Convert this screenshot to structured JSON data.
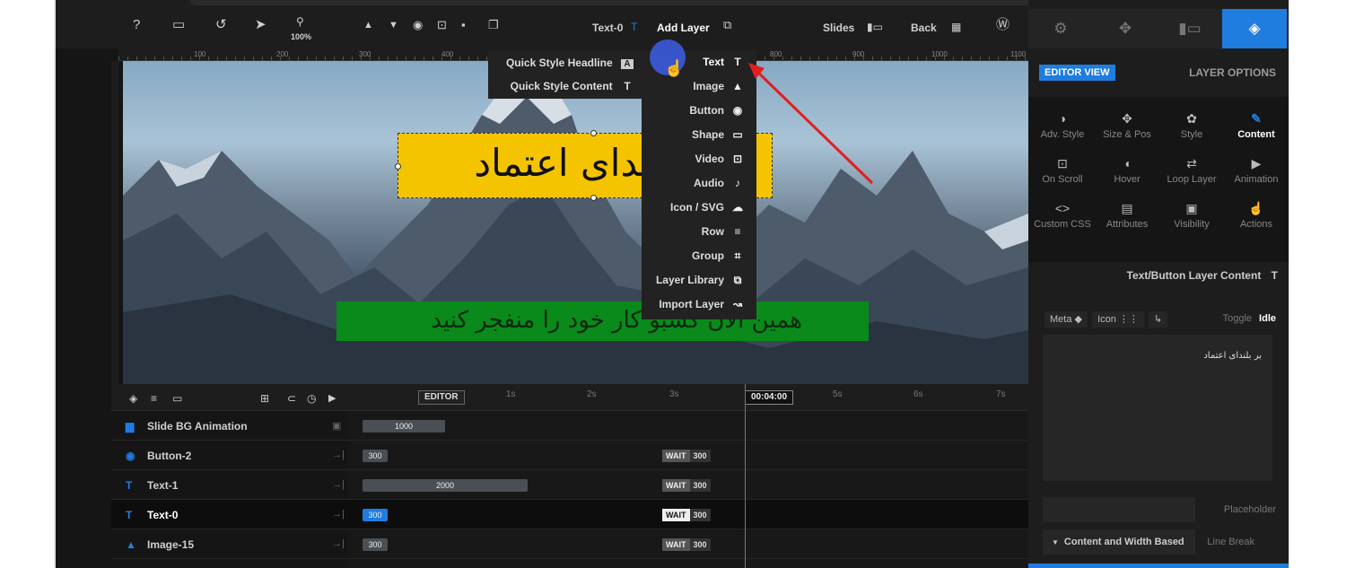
{
  "toolbar": {
    "zoom": "100%",
    "layer_name": "Text-0",
    "add_layer": "Add Layer",
    "slides": "Slides",
    "back": "Back"
  },
  "ruler": {
    "marks": [
      "100",
      "200",
      "300",
      "400",
      "800",
      "900",
      "1000",
      "1100"
    ]
  },
  "canvas": {
    "headline": "بر بلندای اعتماد",
    "subtext": "همین الان کسبو کار خود را منفجر کنید"
  },
  "quick_menu": {
    "items": [
      {
        "label": "Quick Style Headline",
        "icon": "A"
      },
      {
        "label": "Quick Style Content",
        "icon": "T"
      }
    ]
  },
  "add_menu": {
    "items": [
      {
        "label": "Text",
        "icon": "text-icon"
      },
      {
        "label": "Image",
        "icon": "image-icon"
      },
      {
        "label": "Button",
        "icon": "button-icon"
      },
      {
        "label": "Shape",
        "icon": "shape-icon"
      },
      {
        "label": "Video",
        "icon": "video-icon"
      },
      {
        "label": "Audio",
        "icon": "audio-icon"
      },
      {
        "label": "Icon / SVG",
        "icon": "cloud-icon"
      },
      {
        "label": "Row",
        "icon": "row-icon"
      },
      {
        "label": "Group",
        "icon": "group-icon"
      },
      {
        "label": "Layer Library",
        "icon": "library-icon"
      },
      {
        "label": "Import Layer",
        "icon": "import-icon"
      }
    ]
  },
  "timeline": {
    "editor_tag": "EDITOR",
    "current_time": "00:04:00",
    "ticks": [
      "1s",
      "2s",
      "3s",
      "5s",
      "6s",
      "7s"
    ],
    "rows": [
      {
        "name": "Slide BG Animation",
        "bar": "1000",
        "wait": "",
        "delay": ""
      },
      {
        "name": "Button-2",
        "bar": "300",
        "wait": "WAIT",
        "delay": "300"
      },
      {
        "name": "Text-1",
        "bar": "2000",
        "wait": "WAIT",
        "delay": "300"
      },
      {
        "name": "Text-0",
        "bar": "300",
        "wait": "WAIT",
        "delay": "300"
      },
      {
        "name": "Image-15",
        "bar": "300",
        "wait": "WAIT",
        "delay": "300"
      }
    ]
  },
  "sidebar": {
    "editor_view": "EDITOR VIEW",
    "layer_options": "LAYER OPTIONS",
    "grid": [
      {
        "label": "Adv. Style",
        "icon": "adv-style-icon"
      },
      {
        "label": "Size & Pos",
        "icon": "move-icon"
      },
      {
        "label": "Style",
        "icon": "palette-icon"
      },
      {
        "label": "Content",
        "icon": "pencil-icon"
      },
      {
        "label": "On Scroll",
        "icon": "scroll-icon"
      },
      {
        "label": "Hover",
        "icon": "mouse-icon"
      },
      {
        "label": "Loop Layer",
        "icon": "loop-icon"
      },
      {
        "label": "Animation",
        "icon": "play-icon"
      },
      {
        "label": "Custom CSS",
        "icon": "code-icon"
      },
      {
        "label": "Attributes",
        "icon": "file-icon"
      },
      {
        "label": "Visibility",
        "icon": "visibility-icon"
      },
      {
        "label": "Actions",
        "icon": "hand-icon"
      }
    ],
    "section_title": "Text/Button Layer Content",
    "meta": "Meta",
    "icon": "Icon",
    "toggle": "Toggle",
    "idle": "Idle",
    "content_text": "بر بلندای اعتماد",
    "placeholder": "Placeholder",
    "content_width": "Content and Width Based",
    "line_break": "Line Break"
  }
}
